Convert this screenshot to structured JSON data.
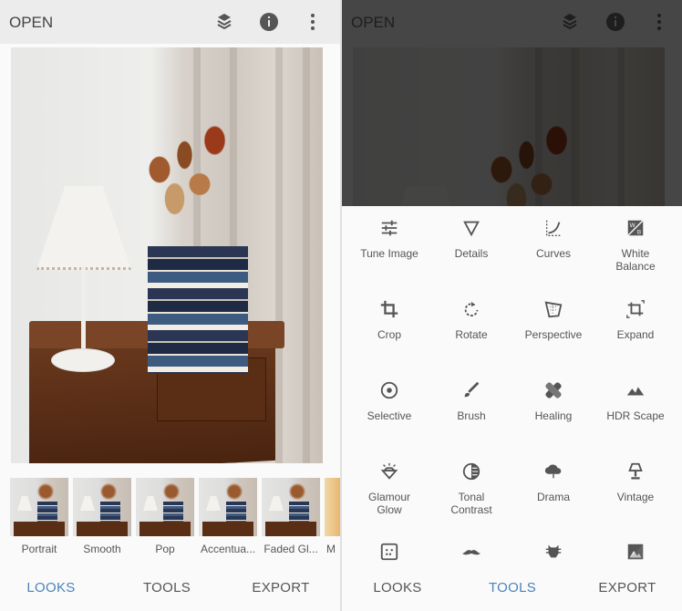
{
  "left": {
    "header": {
      "open_label": "OPEN",
      "icons": [
        "layers-stack-icon",
        "info-icon",
        "more-vert-icon"
      ]
    },
    "looks": [
      {
        "label": "Portrait"
      },
      {
        "label": "Smooth"
      },
      {
        "label": "Pop"
      },
      {
        "label": "Accentua..."
      },
      {
        "label": "Faded Gl..."
      },
      {
        "label": "M"
      }
    ],
    "nav": {
      "looks": "LOOKS",
      "tools": "TOOLS",
      "export": "EXPORT",
      "active": "LOOKS"
    }
  },
  "right": {
    "header": {
      "open_label": "OPEN"
    },
    "tools": [
      {
        "label": "Tune Image",
        "icon": "tune-sliders-icon"
      },
      {
        "label": "Details",
        "icon": "triangle-down-icon"
      },
      {
        "label": "Curves",
        "icon": "curves-icon"
      },
      {
        "label": "White\nBalance",
        "icon": "white-balance-icon"
      },
      {
        "label": "Crop",
        "icon": "crop-icon"
      },
      {
        "label": "Rotate",
        "icon": "rotate-icon"
      },
      {
        "label": "Perspective",
        "icon": "perspective-icon"
      },
      {
        "label": "Expand",
        "icon": "expand-icon"
      },
      {
        "label": "Selective",
        "icon": "selective-target-icon"
      },
      {
        "label": "Brush",
        "icon": "brush-icon"
      },
      {
        "label": "Healing",
        "icon": "bandage-icon"
      },
      {
        "label": "HDR Scape",
        "icon": "mountains-icon"
      },
      {
        "label": "Glamour\nGlow",
        "icon": "diamond-glow-icon"
      },
      {
        "label": "Tonal\nContrast",
        "icon": "tonal-contrast-icon"
      },
      {
        "label": "Drama",
        "icon": "cloud-icon"
      },
      {
        "label": "Vintage",
        "icon": "lamp-icon"
      },
      {
        "label": "",
        "icon": "grainy-film-icon"
      },
      {
        "label": "",
        "icon": "mustache-icon"
      },
      {
        "label": "",
        "icon": "face-icon"
      },
      {
        "label": "",
        "icon": "black-white-icon"
      }
    ],
    "nav": {
      "looks": "LOOKS",
      "tools": "TOOLS",
      "export": "EXPORT",
      "active": "TOOLS"
    }
  },
  "colors": {
    "accent": "#4a83bd",
    "text": "#555555",
    "header": "#ececec"
  }
}
